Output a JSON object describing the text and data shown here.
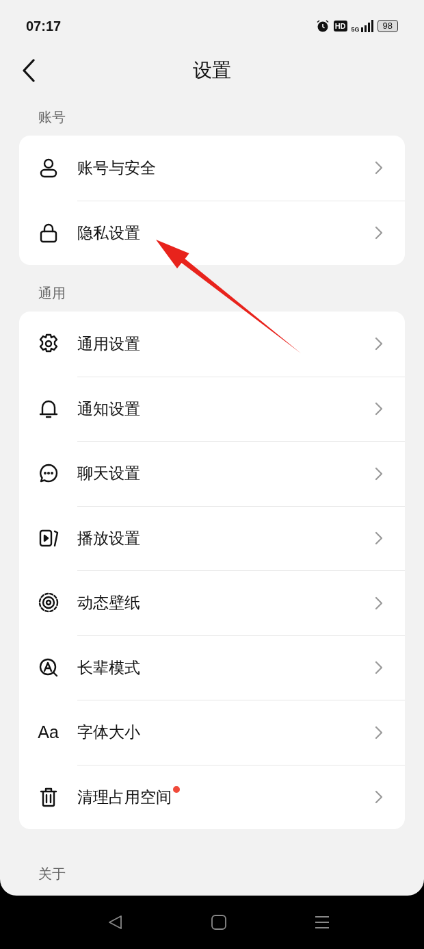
{
  "status_bar": {
    "time": "07:17",
    "hd": "HD",
    "network": "5G",
    "battery": "98"
  },
  "header": {
    "title": "设置"
  },
  "sections": [
    {
      "title": "账号",
      "items": [
        {
          "label": "账号与安全",
          "badge": false
        },
        {
          "label": "隐私设置",
          "badge": false
        }
      ]
    },
    {
      "title": "通用",
      "items": [
        {
          "label": "通用设置",
          "badge": false
        },
        {
          "label": "通知设置",
          "badge": false
        },
        {
          "label": "聊天设置",
          "badge": false
        },
        {
          "label": "播放设置",
          "badge": false
        },
        {
          "label": "动态壁纸",
          "badge": false
        },
        {
          "label": "长辈模式",
          "badge": false
        },
        {
          "label": "字体大小",
          "badge": false,
          "icon_text": "Aa"
        },
        {
          "label": "清理占用空间",
          "badge": true
        }
      ]
    },
    {
      "title": "关于"
    }
  ]
}
